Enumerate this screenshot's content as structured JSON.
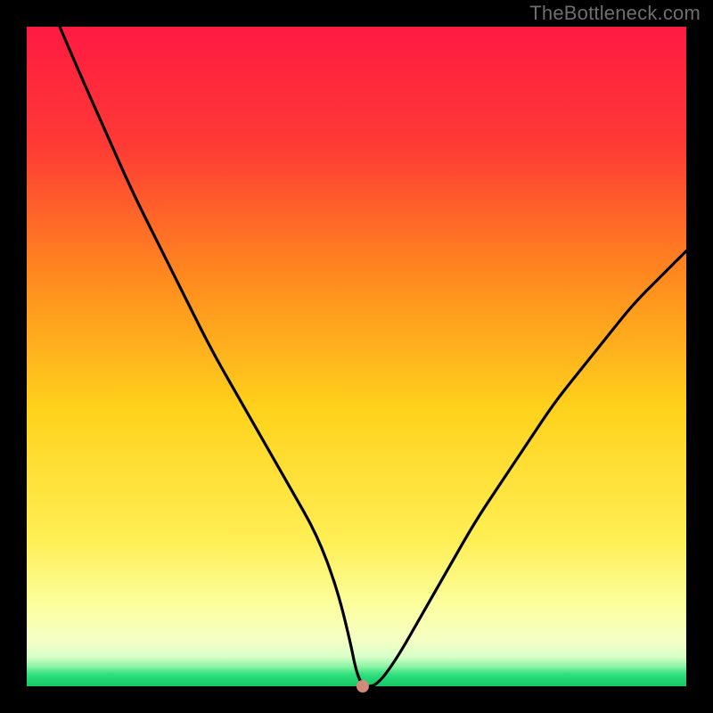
{
  "watermark": "TheBottleneck.com",
  "colors": {
    "top": "#ff1a42",
    "mid_upper": "#ff7a1f",
    "mid": "#ffd21c",
    "mid_lower": "#fff17a",
    "lower_band": "#f8ffa8",
    "green": "#1cd96c",
    "curve": "#000000",
    "marker": "#d28b7a",
    "frame_bg": "#000000"
  },
  "chart_data": {
    "type": "line",
    "title": "",
    "xlabel": "",
    "ylabel": "",
    "xlim": [
      0,
      100
    ],
    "ylim": [
      0,
      100
    ],
    "series": [
      {
        "name": "bottleneck-curve",
        "x": [
          5,
          8,
          12,
          16,
          20,
          24,
          28,
          32,
          36,
          40,
          44,
          47,
          49,
          50,
          51,
          53,
          56,
          60,
          64,
          68,
          72,
          76,
          80,
          84,
          88,
          92,
          96,
          100
        ],
        "values": [
          100,
          93,
          84,
          75,
          67,
          59,
          51,
          44,
          37,
          30,
          23,
          15,
          7,
          2,
          0,
          0,
          4,
          11,
          18,
          25,
          31,
          37,
          43,
          48,
          53,
          58,
          62,
          66
        ]
      }
    ],
    "marker_point": {
      "x": 51,
      "y": 0
    },
    "annotations": [],
    "legend": []
  }
}
